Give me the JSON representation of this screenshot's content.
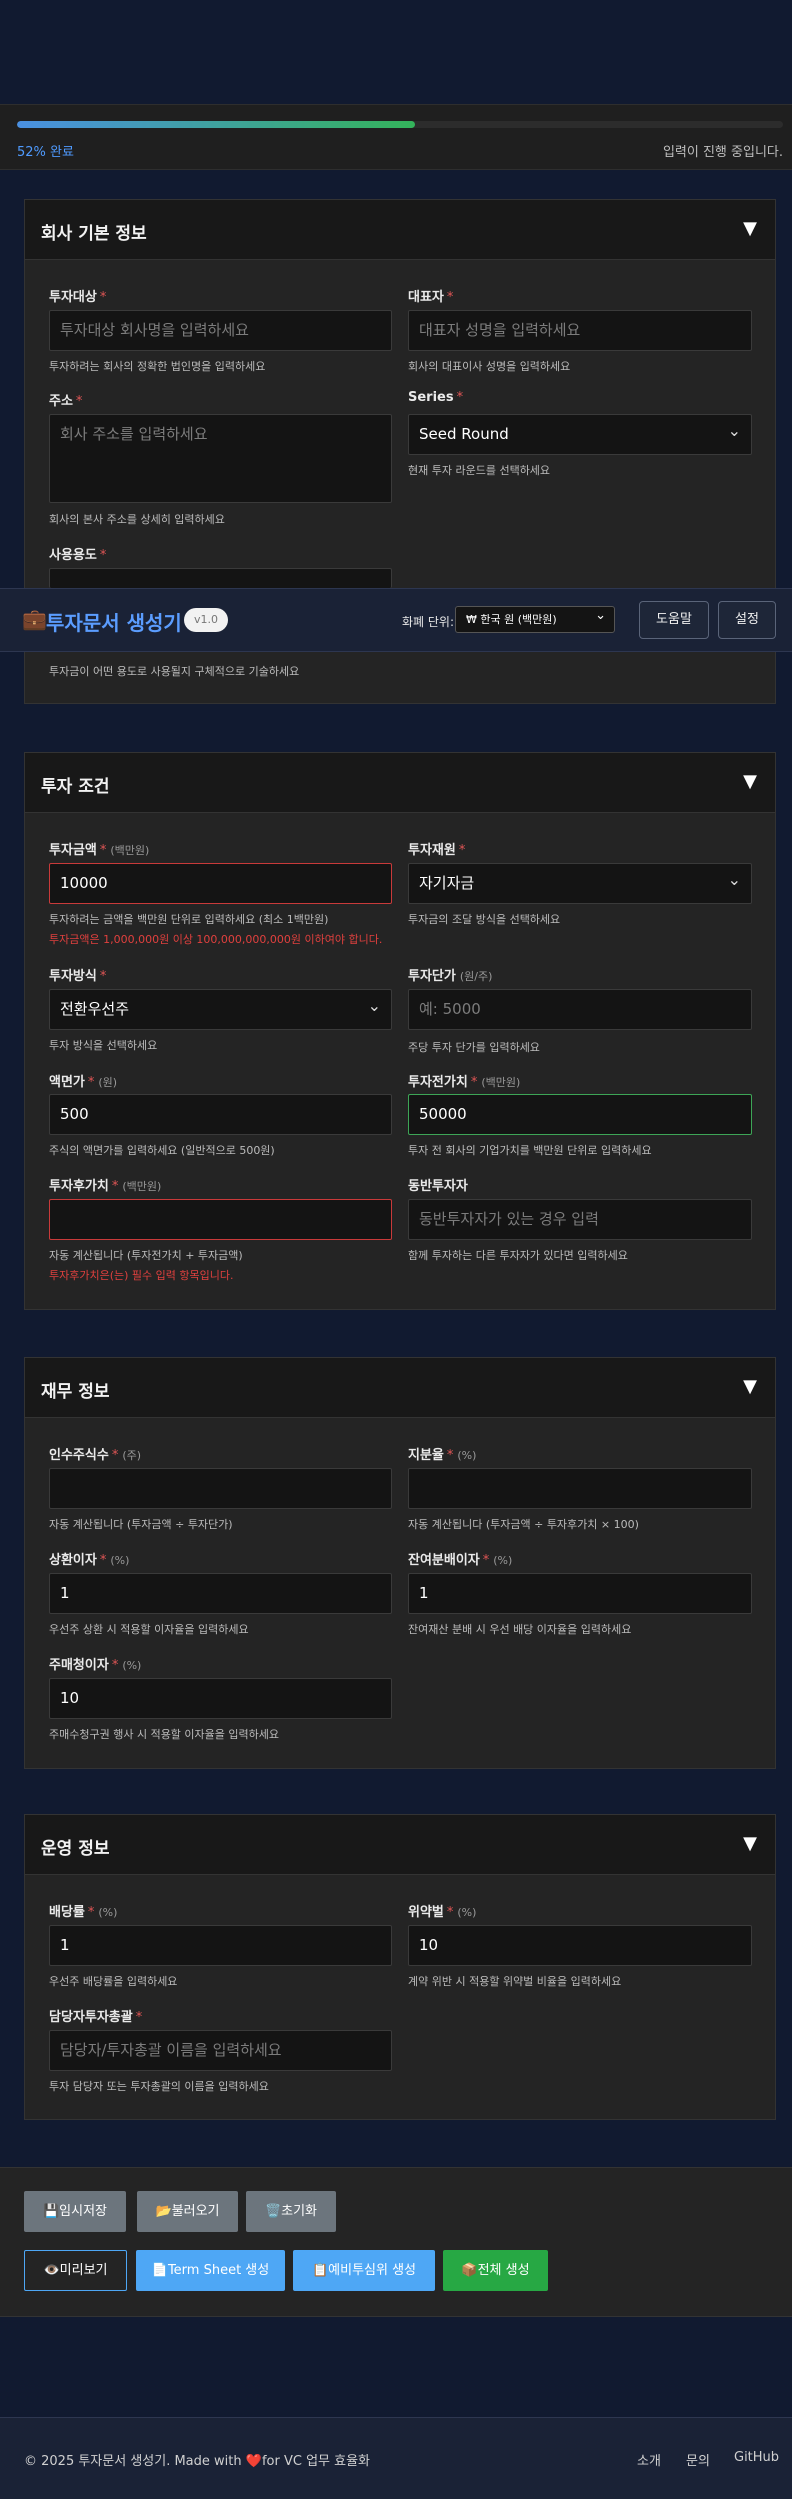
{
  "progress": {
    "percent": 52,
    "percent_label": "52% 완료",
    "status": "입력이 진행 중입니다."
  },
  "header": {
    "title": "투자문서 생성기",
    "version": "v1.0",
    "currency_label": "화폐 단위:",
    "currency_value": "₩ 한국 원 (백만원)",
    "help": "도움말",
    "settings": "설정"
  },
  "company": {
    "title": "회사 기본 정보",
    "toggle": "▼",
    "target_label": "투자대상",
    "target_placeholder": "투자대상 회사명을 입력하세요",
    "target_hint": "투자하려는 회사의 정확한 법인명을 입력하세요",
    "ceo_label": "대표자",
    "ceo_placeholder": "대표자 성명을 입력하세요",
    "ceo_hint": "회사의 대표이사 성명을 입력하세요",
    "address_label": "주소",
    "address_placeholder": "회사 주소를 입력하세요",
    "address_hint": "회사의 본사 주소를 상세히 입력하세요",
    "series_label": "Series",
    "series_value": "Seed Round",
    "series_hint": "현재 투자 라운드를 선택하세요",
    "usage_label": "사용용도",
    "usage_hint": "투자금이 어떤 용도로 사용될지 구체적으로 기술하세요"
  },
  "terms": {
    "title": "투자 조건",
    "toggle": "▼",
    "amount_label": "투자금액",
    "amount_unit": "(백만원)",
    "amount_value": "10000",
    "amount_hint": "투자하려는 금액을 백만원 단위로 입력하세요 (최소 1백만원)",
    "amount_error": "투자금액은 1,000,000원 이상 100,000,000,000원 이하여야 합니다.",
    "source_label": "투자재원",
    "source_value": "자기자금",
    "source_hint": "투자금의 조달 방식을 선택하세요",
    "method_label": "투자방식",
    "method_value": "전환우선주",
    "method_hint": "투자 방식을 선택하세요",
    "price_label": "투자단가",
    "price_unit": "(원/주)",
    "price_placeholder": "예: 5000",
    "price_hint": "주당 투자 단가를 입력하세요",
    "par_label": "액면가",
    "par_unit": "(원)",
    "par_value": "500",
    "par_hint": "주식의 액면가를 입력하세요 (일반적으로 500원)",
    "pre_label": "투자전가치",
    "pre_unit": "(백만원)",
    "pre_value": "50000",
    "pre_hint": "투자 전 회사의 기업가치를 백만원 단위로 입력하세요",
    "post_label": "투자후가치",
    "post_unit": "(백만원)",
    "post_hint": "자동 계산됩니다 (투자전가치 + 투자금액)",
    "post_error": "투자후가치은(는) 필수 입력 항목입니다.",
    "co_label": "동반투자자",
    "co_placeholder": "동반투자자가 있는 경우 입력",
    "co_hint": "함께 투자하는 다른 투자자가 있다면 입력하세요"
  },
  "finance": {
    "title": "재무 정보",
    "toggle": "▼",
    "shares_label": "인수주식수",
    "shares_unit": "(주)",
    "shares_hint": "자동 계산됩니다 (투자금액 ÷ 투자단가)",
    "stake_label": "지분율",
    "stake_unit": "(%)",
    "stake_hint": "자동 계산됩니다 (투자금액 ÷ 투자후가치 × 100)",
    "redeem_label": "상환이자",
    "redeem_unit": "(%)",
    "redeem_value": "1",
    "redeem_hint": "우선주 상환 시 적용할 이자율을 입력하세요",
    "residual_label": "잔여분배이자",
    "residual_unit": "(%)",
    "residual_value": "1",
    "residual_hint": "잔여재산 분배 시 우선 배당 이자율을 입력하세요",
    "buyback_label": "주매청이자",
    "buyback_unit": "(%)",
    "buyback_value": "10",
    "buyback_hint": "주매수청구권 행사 시 적용할 이자율을 입력하세요"
  },
  "ops": {
    "title": "운영 정보",
    "toggle": "▼",
    "dividend_label": "배당률",
    "dividend_unit": "(%)",
    "dividend_value": "1",
    "dividend_hint": "우선주 배당률을 입력하세요",
    "penalty_label": "위약벌",
    "penalty_unit": "(%)",
    "penalty_value": "10",
    "penalty_hint": "계약 위반 시 적용할 위약벌 비율을 입력하세요",
    "manager_label": "담당자투자총괄",
    "manager_placeholder": "담당자/투자총괄 이름을 입력하세요",
    "manager_hint": "투자 담당자 또는 투자총괄의 이름을 입력하세요"
  },
  "actions": {
    "save": "임시저장",
    "load": "불러오기",
    "reset": "초기화",
    "preview": "미리보기",
    "termsheet": "Term Sheet 생성",
    "committee": "예비투심위 생성",
    "all": "전체 생성"
  },
  "footer": {
    "copyright_pre": "© 2025 투자문서 생성기. Made with",
    "copyright_post": "for VC 업무 효율화",
    "about": "소개",
    "contact": "문의",
    "github": "GitHub"
  }
}
